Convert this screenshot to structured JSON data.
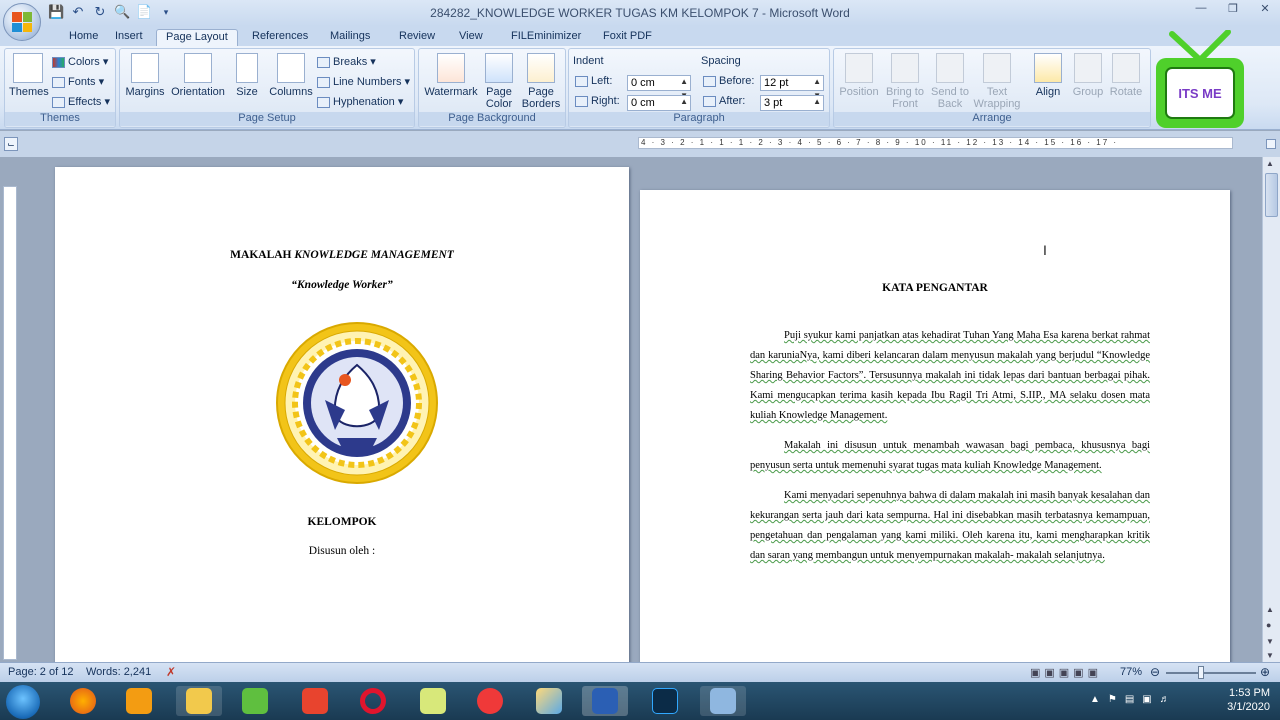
{
  "window": {
    "title": "284282_KNOWLEDGE WORKER TUGAS KM KELOMPOK 7 - Microsoft Word"
  },
  "tabs": [
    "Home",
    "Insert",
    "Page Layout",
    "References",
    "Mailings",
    "Review",
    "View",
    "FILEminimizer",
    "Foxit PDF"
  ],
  "active_tab": "Page Layout",
  "ribbon": {
    "themes": {
      "big": "Themes",
      "colors": "Colors",
      "fonts": "Fonts",
      "effects": "Effects",
      "label": "Themes"
    },
    "page_setup": {
      "margins": "Margins",
      "orientation": "Orientation",
      "size": "Size",
      "columns": "Columns",
      "breaks": "Breaks",
      "line_numbers": "Line Numbers",
      "hyphenation": "Hyphenation",
      "label": "Page Setup"
    },
    "page_background": {
      "watermark": "Watermark",
      "page_color": "Page Color",
      "page_borders": "Page Borders",
      "label": "Page Background"
    },
    "paragraph": {
      "indent_title": "Indent",
      "left_label": "Left:",
      "left_value": "0 cm",
      "right_label": "Right:",
      "right_value": "0 cm",
      "spacing_title": "Spacing",
      "before_label": "Before:",
      "before_value": "12 pt",
      "after_label": "After:",
      "after_value": "3 pt",
      "label": "Paragraph"
    },
    "arrange": {
      "position": "Position",
      "bring_to_front": "Bring to Front",
      "send_to_back": "Send to Back",
      "text_wrapping": "Text Wrapping",
      "align": "Align",
      "group": "Group",
      "rotate": "Rotate",
      "label": "Arrange"
    }
  },
  "ruler_text": "4 · 3 · 2 · 1 · 1 · 1 · 2 · 3 · 4 · 5 · 6 · 7 · 8 · 9 · 10 · 11 · 12 · 13 · 14 · 15 · 16 · 17 ·",
  "page1": {
    "title_plain": "MAKALAH ",
    "title_italic": "KNOWLEDGE MANAGEMENT",
    "subtitle": "“Knowledge Worker”",
    "kelompok": "KELOMPOK",
    "disusun": "Disusun oleh :"
  },
  "page2": {
    "heading": "KATA PENGANTAR",
    "p1": "Puji syukur kami panjatkan atas kehadirat Tuhan Yang Maha Esa karena berkat rahmat dan karuniaNya, kami diberi kelancaran dalam menyusun makalah yang berjudul “Knowledge Sharing Behavior Factors”. Tersusunnya makalah ini tidak lepas dari bantuan berbagai pihak. Kami mengucapkan terima kasih kepada Ibu Ragil Tri Atmi, S.IIP., MA selaku dosen mata kuliah Knowledge Management.",
    "p2": "Makalah ini disusun untuk menambah wawasan bagi pembaca, khususnya bagi penyusun serta untuk memenuhi syarat tugas mata kuliah Knowledge Management.",
    "p3": "Kami menyadari sepenuhnya bahwa di dalam makalah ini masih banyak kesalahan dan kekurangan serta jauh dari kata sempurna. Hal ini disebabkan masih terbatasnya kemampuan, pengetahuan dan pengalaman yang kami miliki. Oleh karena itu, kami mengharapkan kritik dan saran yang membangun untuk menyempurnakan makalah- makalah selanjutnya."
  },
  "status": {
    "page": "Page: 2 of 12",
    "words": "Words: 2,241",
    "zoom": "77%"
  },
  "overlay": {
    "text": "ITS ME"
  },
  "tray": {
    "time": "1:53 PM",
    "date": "3/1/2020"
  }
}
